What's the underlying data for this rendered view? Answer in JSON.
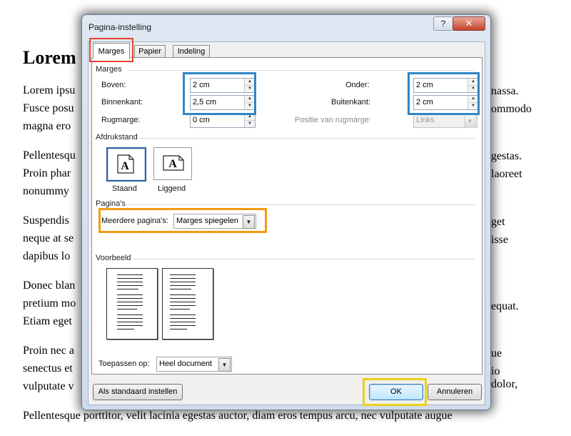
{
  "document": {
    "heading": "Lorem",
    "paragraphs": [
      [
        "Lorem ipsu",
        "Fusce posu",
        "magna ero"
      ],
      [
        "Pellentesqu",
        "Proin phar",
        "nonummy"
      ],
      [
        "Suspendis",
        "neque at se",
        "dapibus lo"
      ],
      [
        "Donec blan",
        "pretium mo",
        "Etiam eget"
      ],
      [
        "Proin nec a",
        "senectus et",
        "vulputate v"
      ],
      [
        "Pellentesque porttitor, velit lacinia egestas auctor, diam eros tempus arcu, nec vulputate augue"
      ]
    ],
    "right_fragments": [
      "nassa.",
      "ommodo",
      "gestas.",
      "laoreet",
      "get",
      "isse",
      "equat.",
      "ue",
      "io dolor,"
    ]
  },
  "dialog": {
    "title": "Pagina-instelling",
    "help_glyph": "?",
    "close_glyph": "✕",
    "tabs": [
      "Marges",
      "Papier",
      "Indeling"
    ],
    "active_tab": "Marges",
    "margins": {
      "section": "Marges",
      "top_label": "Boven:",
      "top_value": "2 cm",
      "inside_label": "Binnenkant:",
      "inside_value": "2,5 cm",
      "gutter_label": "Rugmarge:",
      "gutter_value": "0 cm",
      "bottom_label": "Onder:",
      "bottom_value": "2 cm",
      "outside_label": "Buitenkant:",
      "outside_value": "2 cm",
      "gutter_pos_label": "Positie van rugmarge:",
      "gutter_pos_value": "Links"
    },
    "orientation": {
      "section": "Afdrukstand",
      "portrait": "Staand",
      "landscape": "Liggend",
      "icon_letter": "A",
      "selected": "Staand"
    },
    "pages": {
      "section": "Pagina's",
      "multiple_label": "Meerdere pagina's:",
      "multiple_value": "Marges spiegelen"
    },
    "preview": {
      "section": "Voorbeeld"
    },
    "apply": {
      "label": "Toepassen op:",
      "value": "Heel document"
    },
    "buttons": {
      "default": "Als standaard instellen",
      "ok": "OK",
      "cancel": "Annuleren"
    }
  },
  "colors": {
    "highlight_red": "#e8432e",
    "highlight_blue": "#2f86c5",
    "highlight_orange": "#f29a14",
    "highlight_yellow": "#e8d21a"
  }
}
